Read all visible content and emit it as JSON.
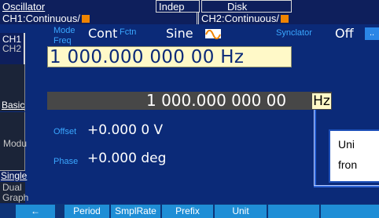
{
  "header": {
    "title": "Oscillator",
    "indep_label": "Indep",
    "disk_label": "Disk",
    "ch1_status": "CH1:Continuous/",
    "ch2_status": "CH2:Continuous/"
  },
  "side_tabs": {
    "ch1": "CH1",
    "ch2": "CH2",
    "basic": "Basic",
    "modu": "Modu",
    "single": "Single",
    "dual_line1": "Dual",
    "dual_line2": "Graph"
  },
  "params": {
    "mode_label": "Mode",
    "mode_value": "Cont",
    "freq_label": "Freq",
    "fctn_label": "Fctn",
    "fctn_value": "Sine",
    "synclator_label": "Synclator",
    "synclator_value": "Off",
    "synclator_btn": "..",
    "freq_display": "1 000.000 000 00 Hz",
    "input_number": "1 000.000 000 00",
    "input_unit": "Hz",
    "offset_label": "Offset",
    "offset_value": "+0.000 0 V",
    "phase_label": "Phase",
    "phase_value": "+0.000 deg"
  },
  "callout": {
    "line1": "Uni",
    "line2": "fron"
  },
  "softkeys": {
    "back": "←",
    "period": "Period",
    "smplrate": "SmplRate",
    "prefix": "Prefix",
    "unit": "Unit",
    "empty": "",
    "last": ""
  },
  "colors": {
    "background": "#0b2a78",
    "header": "#0e1f5c",
    "label_blue": "#3aa7ff",
    "display_yellow": "#fff9c8",
    "input_gray": "#474747",
    "softkey": "#1f8ed6",
    "orange": "#f08400"
  },
  "icons": {
    "waveform": "sine-wave-icon",
    "back": "left-arrow-icon"
  }
}
